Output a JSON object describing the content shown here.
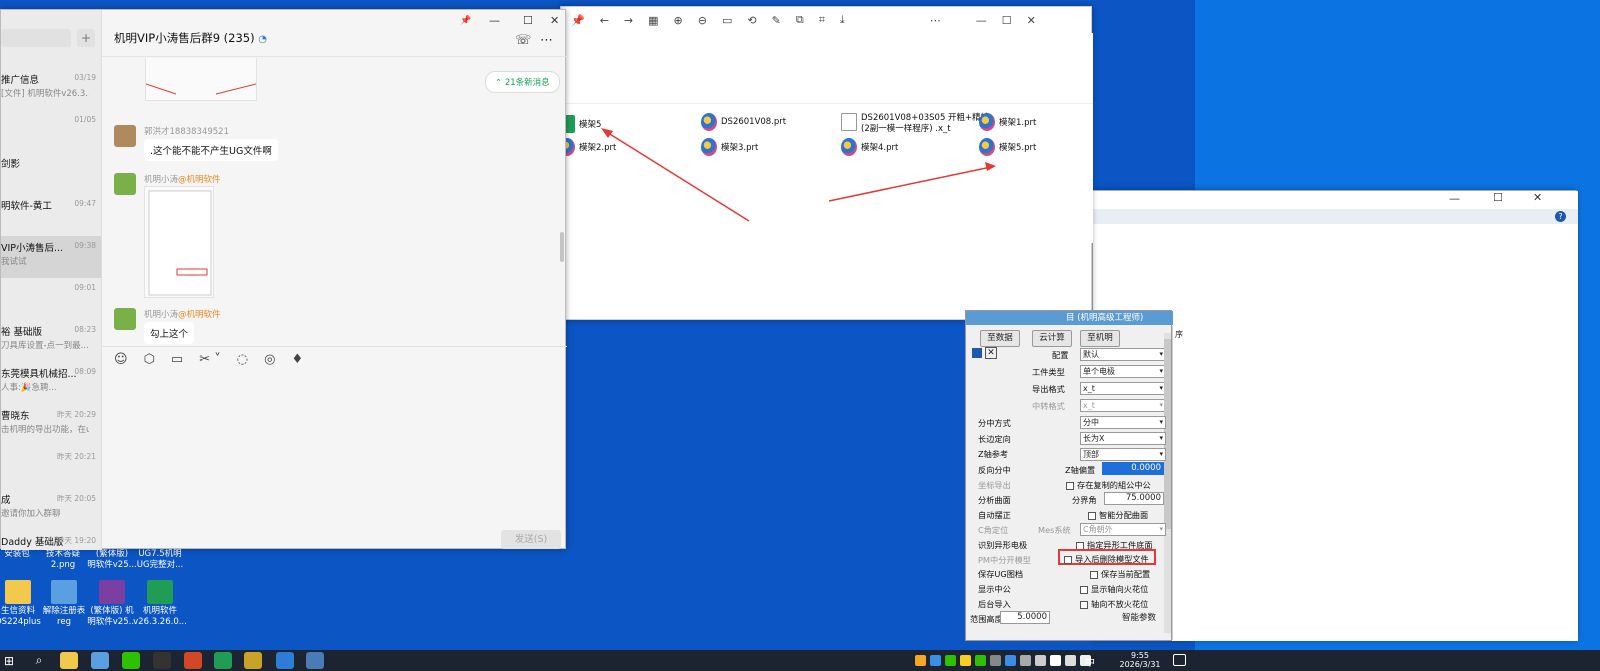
{
  "chat": {
    "title": "机明VIP小涛售后群9 (235)",
    "new_messages": "21条新消息",
    "send_label": "发送(S)",
    "contacts": [
      {
        "name": "推广信息",
        "time": "03/19",
        "preview": "[文件] 机明软件v26.3..."
      },
      {
        "name": "",
        "time": "01/05",
        "preview": ""
      },
      {
        "name": "剑影",
        "time": "",
        "preview": ""
      },
      {
        "name": "明软件-黄工",
        "time": "09:47",
        "preview": ""
      },
      {
        "name": "VIP小涛售后...",
        "time": "09:38",
        "preview": "我试试"
      },
      {
        "name": "",
        "time": "09:01",
        "preview": ""
      },
      {
        "name": "裕 基础版",
        "time": "08:23",
        "preview": "刀具库设置-点一到最..."
      },
      {
        "name": "东莞模具机械招...",
        "time": "08:09",
        "preview": "人事:🎉急聘..."
      },
      {
        "name": "曹晓东",
        "time": "昨天 20:29",
        "preview": "击机明的导出功能，在u..."
      },
      {
        "name": "",
        "time": "昨天 20:21",
        "preview": ""
      },
      {
        "name": "成",
        "time": "昨天 20:05",
        "preview": "邀请你加入群聊"
      },
      {
        "name": "Daddy 基础版",
        "time": "昨天 19:20",
        "preview": ""
      }
    ],
    "messages": [
      {
        "sender": "郭洪才18838349521",
        "text": ".这个能不能不产生UG文件啊"
      },
      {
        "sender": "机明小涛",
        "tag": "@机明软件",
        "text": ""
      },
      {
        "sender": "机明小涛",
        "tag": "@机明软件",
        "text": "勾上这个"
      }
    ]
  },
  "viewer": {
    "files": [
      {
        "name": "模架5",
        "type": "xlsx"
      },
      {
        "name": "DS2601V08.prt",
        "type": "prt"
      },
      {
        "name": "DS2601V08+03S05 开粗+精铣\n(2副一模一样程序) .x_t",
        "type": "doc"
      },
      {
        "name": "模架1.prt",
        "type": "prt"
      },
      {
        "name": "模架2.prt",
        "type": "prt"
      },
      {
        "name": "模架3.prt",
        "type": "prt"
      },
      {
        "name": "模架4.prt",
        "type": "prt"
      },
      {
        "name": "模架5.prt",
        "type": "prt"
      }
    ]
  },
  "panel": {
    "title": "目 (机明高级工程师)",
    "buttons": [
      "至数据",
      "云计算",
      "至机明"
    ],
    "rows": [
      {
        "label": "配置",
        "value": "默认"
      },
      {
        "label": "工件类型",
        "value": "单个电极"
      },
      {
        "label": "导出格式",
        "value": "x_t"
      },
      {
        "label": "中转格式",
        "value": "x_t"
      }
    ],
    "split_label": "分中方式",
    "split_value": "分中",
    "long_side_label": "长边定向",
    "long_side_value": "长为X",
    "z_ref_label": "Z轴参考",
    "z_ref_value": "顶部",
    "reverse_label": "反向分中",
    "z_offset_label": "Z轴偏置",
    "z_offset_value": "0.0000",
    "coord_label": "坐标导出",
    "keep_copy_label": "存在复制的組公中公",
    "analyze_label": "分析曲面",
    "boundary_label": "分界角",
    "boundary_value": "75.0000",
    "auto_label": "自动摆正",
    "smart_label": "智能分配曲面",
    "c_angle_label": "C角定位",
    "mes_label": "Mes系统",
    "mes_value": "C角朝外",
    "identify_label": "识别异形电极",
    "specify_label": "指定异形工件底面",
    "pm_label": "PM中分开模型",
    "delete_label": "导入后删除模型文件",
    "save_ug_label": "保存UG图档",
    "save_cfg_label": "保存当前配置",
    "show_label": "显示中公",
    "show_spark_label": "显示轴向火花位",
    "bg_label": "后台导入",
    "no_spark_label": "轴向不放火花位",
    "height_label": "范围高度",
    "height_value": "5.0000",
    "smart_params": "智能参数",
    "side_header": "序"
  },
  "desktop": {
    "icons": [
      {
        "label": "安装包"
      },
      {
        "label": "技术答疑\n2.png"
      },
      {
        "label": "(繁体版)\n明软件v25..."
      },
      {
        "label": "UG7.5机明\nUG完整对..."
      },
      {
        "label": "生信资料\nDS224plus"
      },
      {
        "label": "解除注册表\nreg"
      },
      {
        "label": "(繁体版) 机\n明软件v25..."
      },
      {
        "label": "机明软件\nv26.3.26.0..."
      }
    ]
  },
  "taskbar": {
    "time": "9:55",
    "date": "2026/3/31",
    "ime": "中"
  }
}
